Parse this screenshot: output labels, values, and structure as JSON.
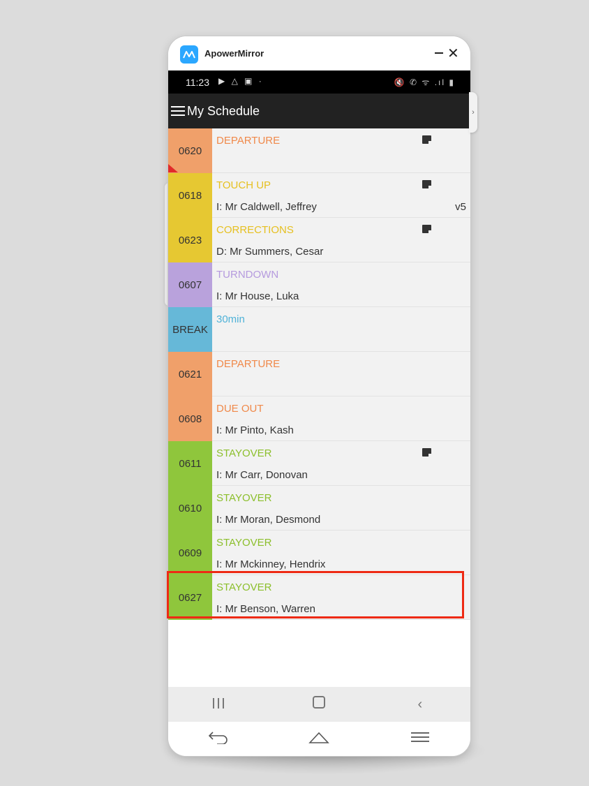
{
  "window": {
    "app_name": "ApowerMirror"
  },
  "statusbar": {
    "time": "11:23",
    "left_icons": "▶ △ ▣  ·",
    "right_icons": "🔇 ✆ ᯤ .ıl ▮"
  },
  "appbar": {
    "title": "My Schedule"
  },
  "colors": {
    "orange": "#f0a06a",
    "yellow": "#e6c832",
    "purple": "#b9a2dc",
    "blue": "#66b8d8",
    "green": "#8fc63c",
    "orange_text": "#f0894a",
    "yellow_text": "#e6c020",
    "purple_text": "#b59ade",
    "blue_text": "#4fb2d8",
    "green_text": "#8cbf2c"
  },
  "rows": [
    {
      "room": "0620",
      "status": "DEPARTURE",
      "guest": "",
      "color": "#f0a06a",
      "status_color": "#f0894a",
      "note": true,
      "version": "",
      "flag": true
    },
    {
      "room": "0618",
      "status": "TOUCH UP",
      "guest": "I: Mr Caldwell, Jeffrey",
      "color": "#e6c832",
      "status_color": "#e6c020",
      "note": true,
      "version": "v5",
      "flag": false
    },
    {
      "room": "0623",
      "status": "CORRECTIONS",
      "guest": "D: Mr Summers, Cesar",
      "color": "#e6c832",
      "status_color": "#e6c020",
      "note": true,
      "version": "",
      "flag": false
    },
    {
      "room": "0607",
      "status": "TURNDOWN",
      "guest": "I: Mr House, Luka",
      "color": "#b9a2dc",
      "status_color": "#b59ade",
      "note": false,
      "version": "",
      "flag": false
    },
    {
      "room": "BREAK",
      "status": "30min",
      "guest": "",
      "color": "#66b8d8",
      "status_color": "#4fb2d8",
      "note": false,
      "version": "",
      "flag": false
    },
    {
      "room": "0621",
      "status": "DEPARTURE",
      "guest": "",
      "color": "#f0a06a",
      "status_color": "#f0894a",
      "note": false,
      "version": "",
      "flag": false
    },
    {
      "room": "0608",
      "status": "DUE OUT",
      "guest": "I: Mr Pinto, Kash",
      "color": "#f0a06a",
      "status_color": "#f0894a",
      "note": false,
      "version": "",
      "flag": false
    },
    {
      "room": "0611",
      "status": "STAYOVER",
      "guest": "I: Mr Carr, Donovan",
      "color": "#8fc63c",
      "status_color": "#8cbf2c",
      "note": true,
      "version": "",
      "flag": false
    },
    {
      "room": "0610",
      "status": "STAYOVER",
      "guest": "I: Mr Moran, Desmond",
      "color": "#8fc63c",
      "status_color": "#8cbf2c",
      "note": false,
      "version": "",
      "flag": false
    },
    {
      "room": "0609",
      "status": "STAYOVER",
      "guest": "I: Mr Mckinney, Hendrix",
      "color": "#8fc63c",
      "status_color": "#8cbf2c",
      "note": false,
      "version": "",
      "flag": false
    },
    {
      "room": "0627",
      "status": "STAYOVER",
      "guest": "I: Mr Benson, Warren",
      "color": "#8fc63c",
      "status_color": "#8cbf2c",
      "note": false,
      "version": "",
      "flag": false
    }
  ],
  "highlight": {
    "color": "#ee2a14",
    "row_room": "0627"
  }
}
